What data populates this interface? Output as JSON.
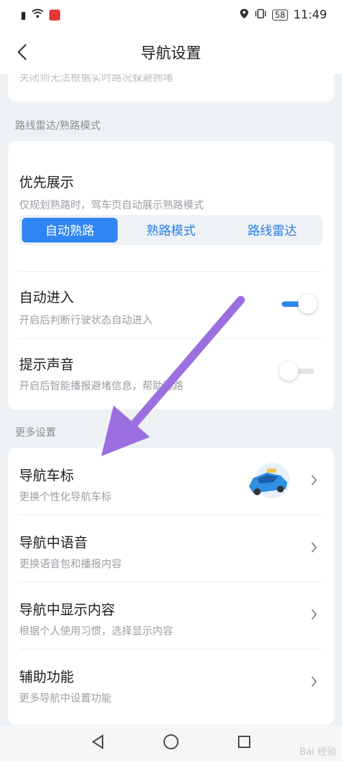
{
  "status_bar": {
    "left_icons": [
      "notification-icon",
      "wifi-icon",
      "recorder-icon"
    ],
    "right_icons": [
      "location-icon",
      "vibrate-icon"
    ],
    "battery": "58",
    "time": "11:49"
  },
  "header": {
    "title": "导航设置",
    "back_icon": "back-chevron-icon"
  },
  "top_card": {
    "cut_subtitle": "关闭则无法根据实时路况躲避拥堵"
  },
  "route_radar_section": {
    "label": "路线雷达/熟路模式",
    "priority_display": {
      "title": "优先展示",
      "subtitle": "仅规划熟路时，驾车页自动展示熟路模式",
      "options": [
        "自动熟路",
        "熟路模式",
        "路线雷达"
      ],
      "selected": "自动熟路"
    },
    "auto_enter": {
      "title": "自动进入",
      "subtitle": "开启后判断行驶状态自动进入",
      "enabled": true
    },
    "sound_prompt": {
      "title": "提示声音",
      "subtitle": "开启后智能播报避堵信息，帮助选路",
      "enabled": false
    }
  },
  "more_section": {
    "label": "更多设置",
    "items": [
      {
        "title": "导航车标",
        "subtitle": "更换个性化导航车标",
        "has_image": true
      },
      {
        "title": "导航中语音",
        "subtitle": "更换语音包和播报内容"
      },
      {
        "title": "导航中显示内容",
        "subtitle": "根据个人使用习惯，选择显示内容"
      },
      {
        "title": "辅助功能",
        "subtitle": "更多导航中设置功能"
      }
    ]
  },
  "colors": {
    "accent": "#2f86f2",
    "annotation_arrow": "#9b6fe0"
  },
  "system_nav": [
    "back-triangle-icon",
    "home-circle-icon",
    "recents-square-icon"
  ],
  "watermark": "Bai 经验"
}
